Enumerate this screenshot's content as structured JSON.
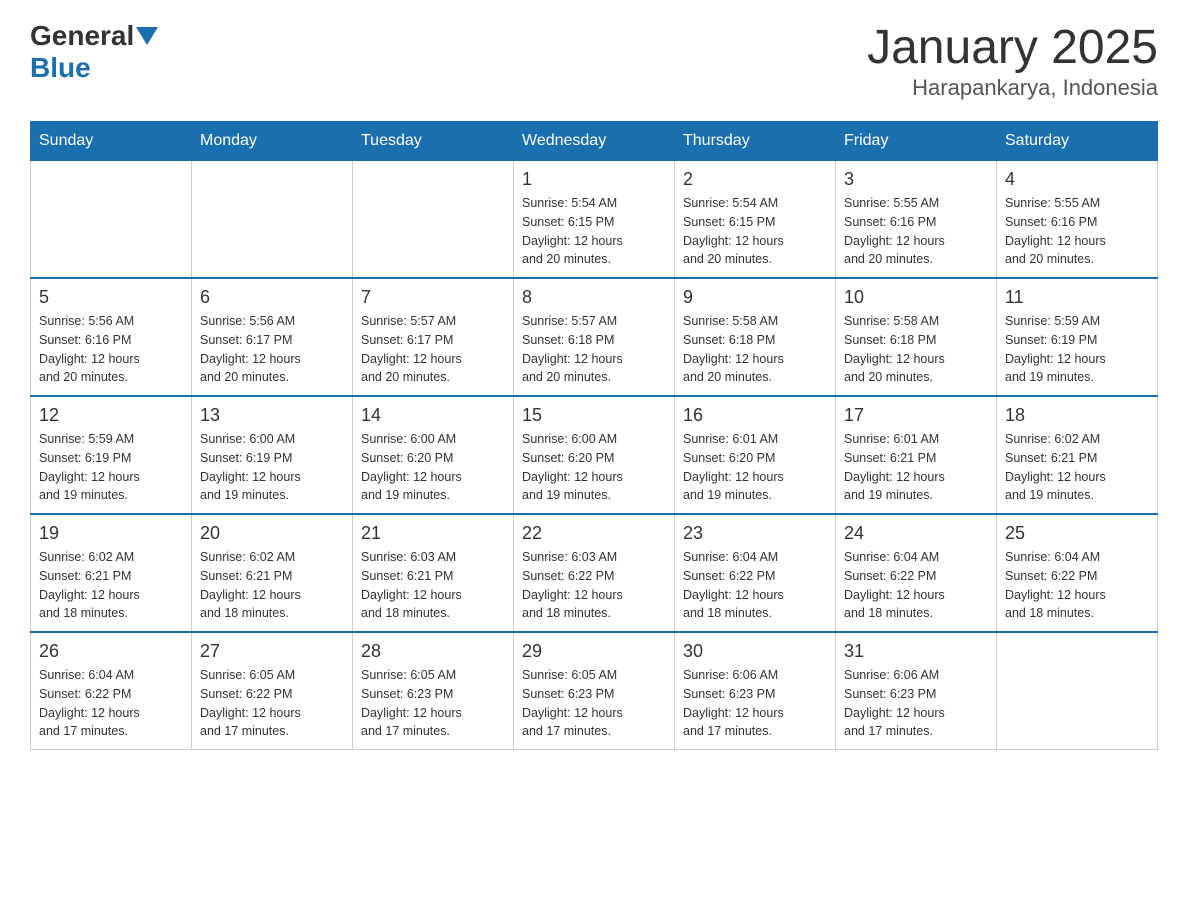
{
  "header": {
    "logo_general": "General",
    "logo_blue": "Blue",
    "title": "January 2025",
    "subtitle": "Harapankarya, Indonesia"
  },
  "days_of_week": [
    "Sunday",
    "Monday",
    "Tuesday",
    "Wednesday",
    "Thursday",
    "Friday",
    "Saturday"
  ],
  "weeks": [
    {
      "days": [
        {
          "number": "",
          "info": ""
        },
        {
          "number": "",
          "info": ""
        },
        {
          "number": "",
          "info": ""
        },
        {
          "number": "1",
          "info": "Sunrise: 5:54 AM\nSunset: 6:15 PM\nDaylight: 12 hours\nand 20 minutes."
        },
        {
          "number": "2",
          "info": "Sunrise: 5:54 AM\nSunset: 6:15 PM\nDaylight: 12 hours\nand 20 minutes."
        },
        {
          "number": "3",
          "info": "Sunrise: 5:55 AM\nSunset: 6:16 PM\nDaylight: 12 hours\nand 20 minutes."
        },
        {
          "number": "4",
          "info": "Sunrise: 5:55 AM\nSunset: 6:16 PM\nDaylight: 12 hours\nand 20 minutes."
        }
      ]
    },
    {
      "days": [
        {
          "number": "5",
          "info": "Sunrise: 5:56 AM\nSunset: 6:16 PM\nDaylight: 12 hours\nand 20 minutes."
        },
        {
          "number": "6",
          "info": "Sunrise: 5:56 AM\nSunset: 6:17 PM\nDaylight: 12 hours\nand 20 minutes."
        },
        {
          "number": "7",
          "info": "Sunrise: 5:57 AM\nSunset: 6:17 PM\nDaylight: 12 hours\nand 20 minutes."
        },
        {
          "number": "8",
          "info": "Sunrise: 5:57 AM\nSunset: 6:18 PM\nDaylight: 12 hours\nand 20 minutes."
        },
        {
          "number": "9",
          "info": "Sunrise: 5:58 AM\nSunset: 6:18 PM\nDaylight: 12 hours\nand 20 minutes."
        },
        {
          "number": "10",
          "info": "Sunrise: 5:58 AM\nSunset: 6:18 PM\nDaylight: 12 hours\nand 20 minutes."
        },
        {
          "number": "11",
          "info": "Sunrise: 5:59 AM\nSunset: 6:19 PM\nDaylight: 12 hours\nand 19 minutes."
        }
      ]
    },
    {
      "days": [
        {
          "number": "12",
          "info": "Sunrise: 5:59 AM\nSunset: 6:19 PM\nDaylight: 12 hours\nand 19 minutes."
        },
        {
          "number": "13",
          "info": "Sunrise: 6:00 AM\nSunset: 6:19 PM\nDaylight: 12 hours\nand 19 minutes."
        },
        {
          "number": "14",
          "info": "Sunrise: 6:00 AM\nSunset: 6:20 PM\nDaylight: 12 hours\nand 19 minutes."
        },
        {
          "number": "15",
          "info": "Sunrise: 6:00 AM\nSunset: 6:20 PM\nDaylight: 12 hours\nand 19 minutes."
        },
        {
          "number": "16",
          "info": "Sunrise: 6:01 AM\nSunset: 6:20 PM\nDaylight: 12 hours\nand 19 minutes."
        },
        {
          "number": "17",
          "info": "Sunrise: 6:01 AM\nSunset: 6:21 PM\nDaylight: 12 hours\nand 19 minutes."
        },
        {
          "number": "18",
          "info": "Sunrise: 6:02 AM\nSunset: 6:21 PM\nDaylight: 12 hours\nand 19 minutes."
        }
      ]
    },
    {
      "days": [
        {
          "number": "19",
          "info": "Sunrise: 6:02 AM\nSunset: 6:21 PM\nDaylight: 12 hours\nand 18 minutes."
        },
        {
          "number": "20",
          "info": "Sunrise: 6:02 AM\nSunset: 6:21 PM\nDaylight: 12 hours\nand 18 minutes."
        },
        {
          "number": "21",
          "info": "Sunrise: 6:03 AM\nSunset: 6:21 PM\nDaylight: 12 hours\nand 18 minutes."
        },
        {
          "number": "22",
          "info": "Sunrise: 6:03 AM\nSunset: 6:22 PM\nDaylight: 12 hours\nand 18 minutes."
        },
        {
          "number": "23",
          "info": "Sunrise: 6:04 AM\nSunset: 6:22 PM\nDaylight: 12 hours\nand 18 minutes."
        },
        {
          "number": "24",
          "info": "Sunrise: 6:04 AM\nSunset: 6:22 PM\nDaylight: 12 hours\nand 18 minutes."
        },
        {
          "number": "25",
          "info": "Sunrise: 6:04 AM\nSunset: 6:22 PM\nDaylight: 12 hours\nand 18 minutes."
        }
      ]
    },
    {
      "days": [
        {
          "number": "26",
          "info": "Sunrise: 6:04 AM\nSunset: 6:22 PM\nDaylight: 12 hours\nand 17 minutes."
        },
        {
          "number": "27",
          "info": "Sunrise: 6:05 AM\nSunset: 6:22 PM\nDaylight: 12 hours\nand 17 minutes."
        },
        {
          "number": "28",
          "info": "Sunrise: 6:05 AM\nSunset: 6:23 PM\nDaylight: 12 hours\nand 17 minutes."
        },
        {
          "number": "29",
          "info": "Sunrise: 6:05 AM\nSunset: 6:23 PM\nDaylight: 12 hours\nand 17 minutes."
        },
        {
          "number": "30",
          "info": "Sunrise: 6:06 AM\nSunset: 6:23 PM\nDaylight: 12 hours\nand 17 minutes."
        },
        {
          "number": "31",
          "info": "Sunrise: 6:06 AM\nSunset: 6:23 PM\nDaylight: 12 hours\nand 17 minutes."
        },
        {
          "number": "",
          "info": ""
        }
      ]
    }
  ]
}
